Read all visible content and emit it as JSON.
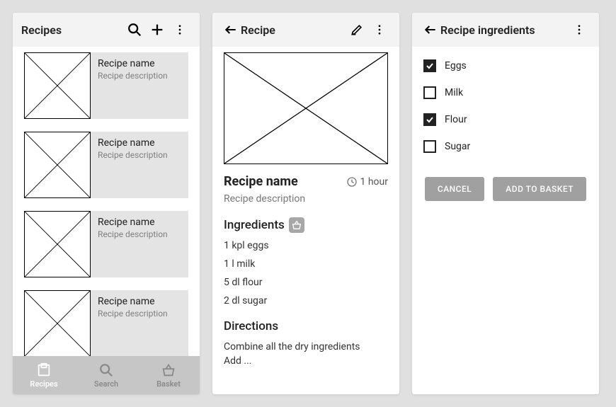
{
  "screen1": {
    "title": "Recipes",
    "items": [
      {
        "name": "Recipe name",
        "desc": "Recipe description"
      },
      {
        "name": "Recipe name",
        "desc": "Recipe description"
      },
      {
        "name": "Recipe name",
        "desc": "Recipe description"
      },
      {
        "name": "Recipe name",
        "desc": "Recipe description"
      }
    ],
    "nav": {
      "recipes": "Recipes",
      "search": "Search",
      "basket": "Basket"
    }
  },
  "screen2": {
    "title": "Recipe",
    "name": "Recipe name",
    "desc": "Recipe description",
    "time": "1 hour",
    "ingredients_heading": "Ingredients",
    "ingredients": [
      "1 kpl eggs",
      "1 l milk",
      "5 dl flour",
      "2 dl sugar"
    ],
    "directions_heading": "Directions",
    "directions": "Combine all the dry ingredients\nAdd ..."
  },
  "screen3": {
    "title": "Recipe ingredients",
    "items": [
      {
        "label": "Eggs",
        "checked": true
      },
      {
        "label": "Milk",
        "checked": false
      },
      {
        "label": "Flour",
        "checked": true
      },
      {
        "label": "Sugar",
        "checked": false
      }
    ],
    "cancel": "CANCEL",
    "add": "ADD TO BASKET"
  }
}
